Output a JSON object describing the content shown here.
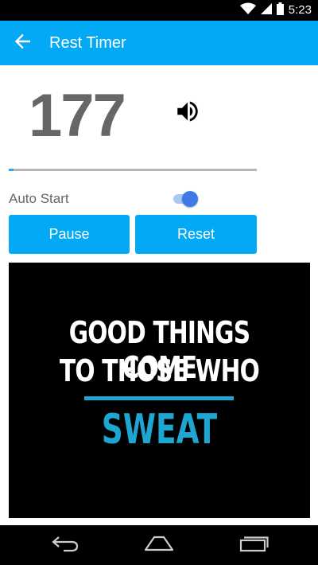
{
  "status_bar": {
    "time": "5:23",
    "icons": [
      "wifi-icon",
      "signal-icon",
      "battery-icon"
    ]
  },
  "app_bar": {
    "title": "Rest Timer",
    "back_icon": "arrow-back-icon",
    "background": "#03a9f4"
  },
  "timer": {
    "value": "177",
    "volume_icon": "volume-up-icon"
  },
  "progress": {
    "fraction": 0.02,
    "fill_color": "#29a8e6"
  },
  "auto_start": {
    "label": "Auto Start",
    "enabled": true
  },
  "buttons": {
    "pause_label": "Pause",
    "reset_label": "Reset"
  },
  "motivation": {
    "line1": "GOOD THINGS COME",
    "line2": "TO THOSE WHO",
    "highlight": "SWEAT",
    "highlight_color": "#1ea6d3"
  },
  "nav_bar": {
    "icons": [
      "nav-back-icon",
      "nav-home-icon",
      "nav-recents-icon"
    ]
  }
}
